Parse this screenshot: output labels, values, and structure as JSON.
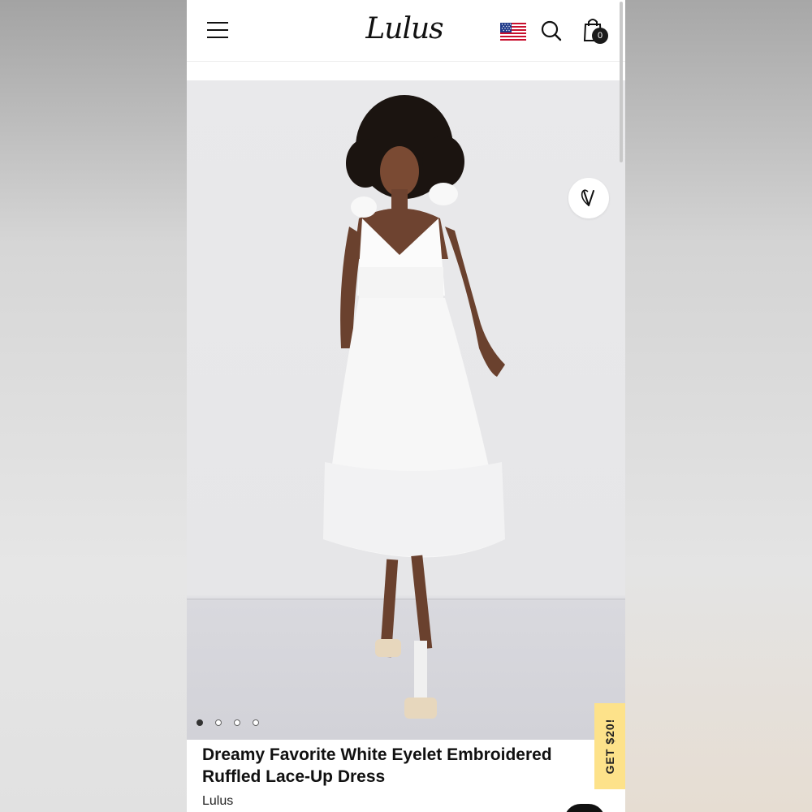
{
  "header": {
    "logo_text": "Lulus",
    "cart_count": "0",
    "icons": {
      "menu": "hamburger-menu-icon",
      "flag": "us-flag-icon",
      "search": "search-icon",
      "cart": "shopping-bag-icon"
    }
  },
  "gallery": {
    "slide_count": 4,
    "active_slide": 1,
    "favorite_icon": "heart-icon"
  },
  "promo": {
    "label": "GET $20!",
    "color": "#fde28a"
  },
  "product": {
    "title": "Dreamy Favorite White Eyelet Embroidered Ruffled Lace-Up Dress",
    "brand": "Lulus"
  },
  "colors": {
    "text": "#111111",
    "badge": "#1a1a1a",
    "background": "#ffffff"
  }
}
